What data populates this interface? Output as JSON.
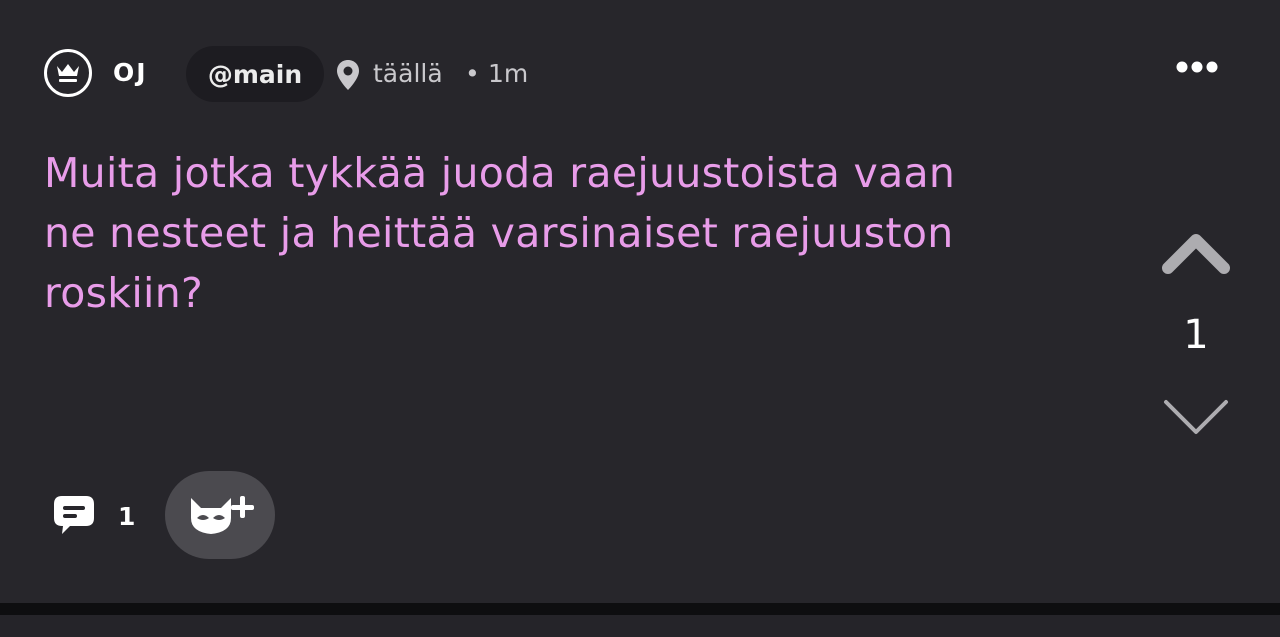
{
  "header": {
    "avatar_icon": "crown-icon",
    "username": "OJ",
    "channel": "@main",
    "location_icon": "map-pin-icon",
    "location": "täällä",
    "separator": "•",
    "time": "1m",
    "more_icon": "more-horizontal-icon"
  },
  "post": {
    "text": "Muita jotka tykkää juoda raejuustoista vaan ne nesteet ja heittää varsinaiset raejuuston roskiin?",
    "text_color": "#e89ce9"
  },
  "votes": {
    "upvote_icon": "chevron-up-icon",
    "score": "1",
    "downvote_icon": "chevron-down-icon"
  },
  "footer": {
    "comment_icon": "comment-icon",
    "comment_count": "1",
    "invite_icon": "fox-plus-icon"
  },
  "colors": {
    "background": "#27262b",
    "pill": "#1d1c21",
    "invite_button": "#4b4a4f",
    "divider": "#0e0e10"
  }
}
